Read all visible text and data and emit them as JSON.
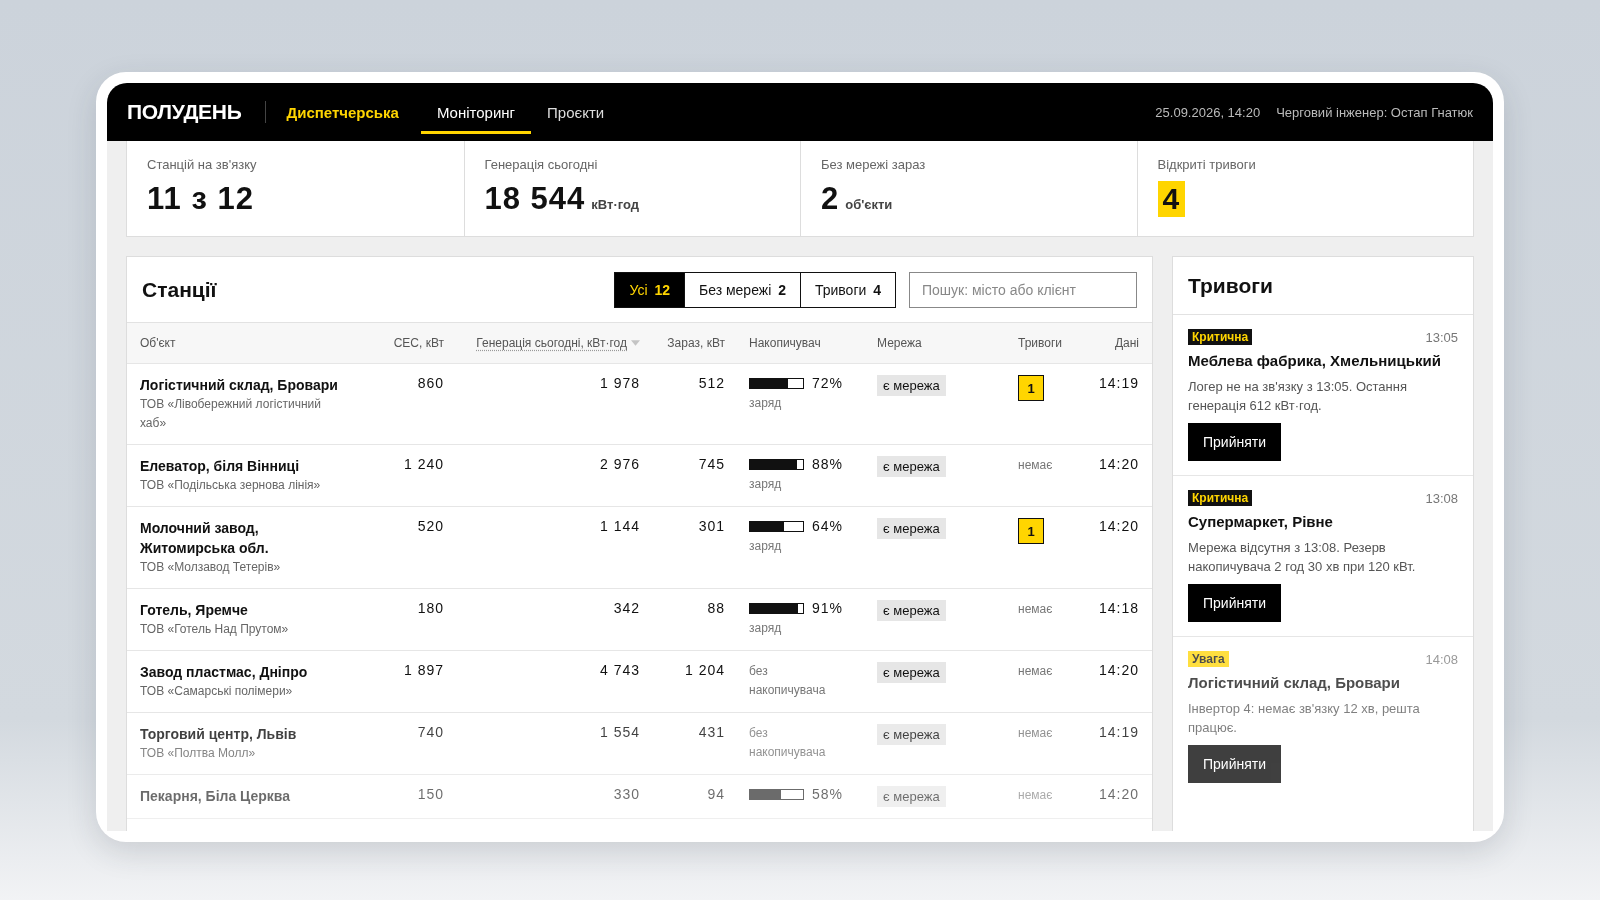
{
  "header": {
    "logo": "ПОЛУДЕНЬ",
    "product": "Диспетчерська",
    "nav": [
      {
        "label": "Моніторинг",
        "selected": true
      },
      {
        "label": "Проєкти",
        "selected": false
      }
    ],
    "datetime": "25.09.2026, 14:20",
    "engineer": "Черговий інженер: Остап Гнатюк"
  },
  "kpis": [
    {
      "label": "Станцій на зв'язку",
      "value": "11 з 12",
      "kind": "plain"
    },
    {
      "label": "Генерація сьогодні",
      "value": "18 544",
      "unit": "кВт·год",
      "kind": "plain"
    },
    {
      "label": "Без мережі зараз",
      "value": "2",
      "unit": "об'єкти",
      "kind": "plain"
    },
    {
      "label": "Відкриті тривоги",
      "value": "4",
      "kind": "highlight"
    }
  ],
  "stations": {
    "title": "Станції",
    "filters": [
      {
        "label": "Усі",
        "count": "12",
        "selected": true
      },
      {
        "label": "Без мережі",
        "count": "2",
        "selected": false
      },
      {
        "label": "Тривоги",
        "count": "4",
        "selected": false
      }
    ],
    "search": {
      "placeholder": "Пошук: місто або клієнт"
    },
    "columns": [
      "Об'єкт",
      "СЕС, кВт",
      "Генерація сьогодні, кВт·год",
      "Зараз, кВт",
      "Накопичувач",
      "Мережа",
      "Тривоги",
      "Дані"
    ],
    "rows": [
      {
        "name": "Логістичний склад, Бровари",
        "client": "ТОВ «Лівобережний логістичний хаб»",
        "ses": "860",
        "gen": "1 978",
        "now": "512",
        "storage": {
          "kind": "battery",
          "level": 0.72,
          "pct": "72%",
          "note": "заряд"
        },
        "grid": "є мережа",
        "alarms": {
          "kind": "count",
          "text": "1"
        },
        "time": "14:19"
      },
      {
        "name": "Елеватор, біля Вінниці",
        "client": "ТОВ «Подільська зернова лінія»",
        "ses": "1 240",
        "gen": "2 976",
        "now": "745",
        "storage": {
          "kind": "battery",
          "level": 0.88,
          "pct": "88%",
          "note": "заряд"
        },
        "grid": "є мережа",
        "alarms": {
          "kind": "none",
          "text": "немає"
        },
        "time": "14:20"
      },
      {
        "name": "Молочний завод, Житомирська обл.",
        "client": "ТОВ «Молзавод Тетерів»",
        "ses": "520",
        "gen": "1 144",
        "now": "301",
        "storage": {
          "kind": "battery",
          "level": 0.64,
          "pct": "64%",
          "note": "заряд"
        },
        "grid": "є мережа",
        "alarms": {
          "kind": "count",
          "text": "1"
        },
        "time": "14:20"
      },
      {
        "name": "Готель, Яремче",
        "client": "ТОВ «Готель Над Прутом»",
        "ses": "180",
        "gen": "342",
        "now": "88",
        "storage": {
          "kind": "battery",
          "level": 0.91,
          "pct": "91%",
          "note": "заряд"
        },
        "grid": "є мережа",
        "alarms": {
          "kind": "none",
          "text": "немає"
        },
        "time": "14:18"
      },
      {
        "name": "Завод пластмас, Дніпро",
        "client": "ТОВ «Самарські полімери»",
        "ses": "1 897",
        "gen": "4 743",
        "now": "1 204",
        "storage": {
          "kind": "none",
          "note": "без накопичувача"
        },
        "grid": "є мережа",
        "alarms": {
          "kind": "none",
          "text": "немає"
        },
        "time": "14:20"
      },
      {
        "name": "Торговий центр, Львів",
        "client": "ТОВ «Полтва Молл»",
        "ses": "740",
        "gen": "1 554",
        "now": "431",
        "storage": {
          "kind": "none",
          "note": "без накопичувача"
        },
        "grid": "є мережа",
        "alarms": {
          "kind": "none",
          "text": "немає"
        },
        "time": "14:19"
      },
      {
        "name": "Пекарня, Біла Церква",
        "ses": "150",
        "gen": "330",
        "now": "94",
        "storage": {
          "kind": "battery",
          "level": 0.58,
          "pct": "58%"
        },
        "grid": "є мережа",
        "alarms": {
          "kind": "none",
          "text": "немає"
        },
        "time": "14:20"
      }
    ]
  },
  "alarms": {
    "title": "Тривоги",
    "items": [
      {
        "severity": "Критична",
        "kind": "critical",
        "time": "13:05",
        "object": "Меблева фабрика, Хмельницький",
        "text": "Логер не на зв'язку з 13:05. Остання генерація 612 кВт·год.",
        "action": "Прийняти"
      },
      {
        "severity": "Критична",
        "kind": "critical",
        "time": "13:08",
        "object": "Супермаркет, Рівне",
        "text": "Мережа відсутня з 13:08. Резерв накопичувача 2 год 30 хв при 120 кВт.",
        "action": "Прийняти"
      },
      {
        "severity": "Увага",
        "kind": "warning",
        "time": "14:08",
        "object": "Логістичний склад, Бровари",
        "text": "Інвертор 4: немає зв'язку 12 хв, решта працює.",
        "action": "Прийняти"
      }
    ]
  }
}
